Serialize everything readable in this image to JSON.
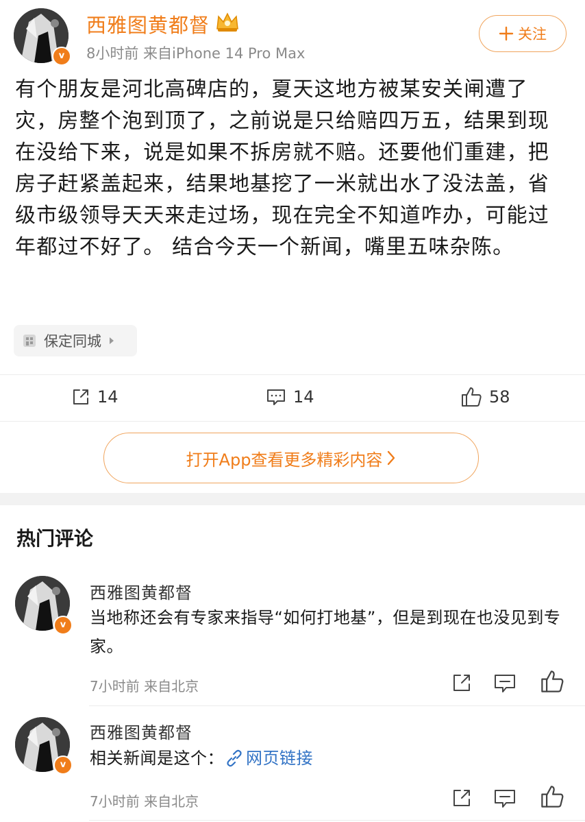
{
  "post": {
    "author": "西雅图黄都督",
    "meta": "8小时前  来自iPhone 14 Pro Max",
    "follow_label": "关注",
    "text": "有个朋友是河北高碑店的，夏天这地方被某安关闸遭了灾，房整个泡到顶了，之前说是只给赔四万五，结果到现在没给下来，说是如果不拆房就不赔。还要他们重建，把房子赶紧盖起来，结果地基挖了一米就出水了没法盖，省级市级领导天天来走过场，现在完全不知道咋办，可能过年都过不好了。 结合今天一个新闻，嘴里五味杂陈。",
    "location": "保定同城",
    "actions": {
      "repost": "14",
      "comment": "14",
      "like": "58"
    },
    "open_app": "打开App查看更多精彩内容"
  },
  "comments_section": {
    "title": "热门评论",
    "comments": [
      {
        "author": "西雅图黄都督",
        "text": "当地称还会有专家来指导“如何打地基”，但是到现在也没见到专家。",
        "meta": "7小时前 来自北京"
      },
      {
        "author": "西雅图黄都督",
        "text_prefix": "相关新闻是这个：",
        "link_text": "网页链接",
        "meta": "7小时前 来自北京"
      }
    ]
  },
  "colors": {
    "accent": "#f07d1a",
    "link": "#3273c5",
    "muted": "#8a8a8a"
  },
  "icons": [
    "avatar-image",
    "verified-badge",
    "crown-icon",
    "plus-icon",
    "location-icon",
    "chevron-right-icon",
    "repost-icon",
    "comment-icon",
    "like-icon",
    "link-icon",
    "share-icon"
  ]
}
